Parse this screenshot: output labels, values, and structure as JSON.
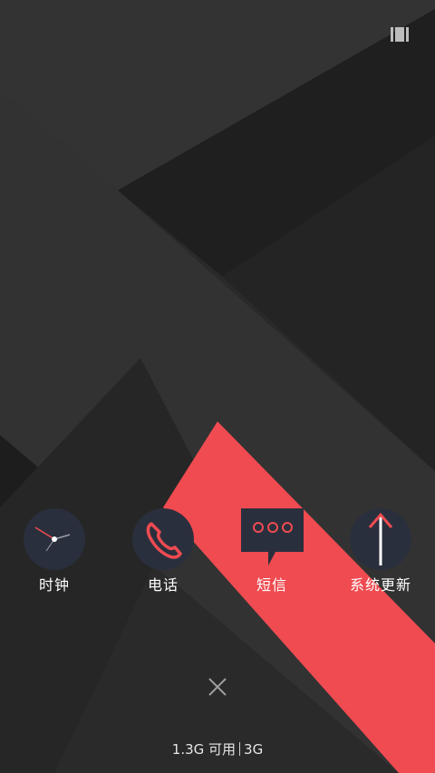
{
  "apps": [
    {
      "label": "时钟",
      "icon": "clock-icon"
    },
    {
      "label": "电话",
      "icon": "phone-icon"
    },
    {
      "label": "短信",
      "icon": "message-icon"
    },
    {
      "label": "系统更新",
      "icon": "system-update-icon"
    }
  ],
  "memory": {
    "available": "1.3G 可用",
    "total": "3G"
  },
  "close": {
    "icon": "close-icon"
  },
  "status": {
    "icon": "recents-layout-icon"
  },
  "colors": {
    "accent": "#ef4b51",
    "icon_bg": "#2a2f3d",
    "background": "#2b2b2b"
  }
}
